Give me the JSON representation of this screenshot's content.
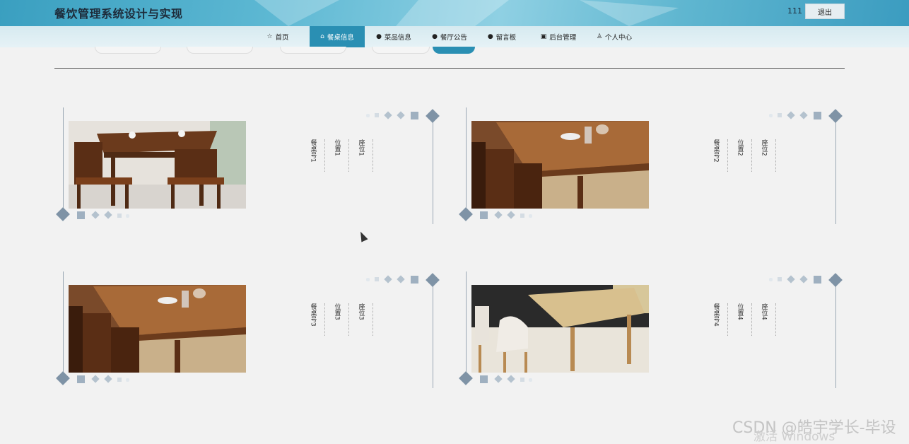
{
  "app": {
    "title": "餐饮管理系统设计与实现",
    "username": "111",
    "logout_label": "退出"
  },
  "nav": [
    {
      "label": "首页",
      "icon": "star-icon",
      "glyph": "☆"
    },
    {
      "label": "餐桌信息",
      "icon": "bag-icon",
      "glyph": "⌂"
    },
    {
      "label": "菜品信息",
      "icon": "info-circle-icon",
      "glyph": "●"
    },
    {
      "label": "餐厅公告",
      "icon": "question-circle-icon",
      "glyph": "●"
    },
    {
      "label": "留言板",
      "icon": "info-circle-icon",
      "glyph": "●"
    },
    {
      "label": "后台管理",
      "icon": "briefcase-icon",
      "glyph": "▣"
    },
    {
      "label": "个人中心",
      "icon": "user-icon",
      "glyph": "♙"
    }
  ],
  "active_nav": "餐桌信息",
  "cards": [
    {
      "table_no": "餐桌号1",
      "position": "位置1",
      "seats": "座位1"
    },
    {
      "table_no": "餐桌号2",
      "position": "位置2",
      "seats": "座位2"
    },
    {
      "table_no": "餐桌号3",
      "position": "位置3",
      "seats": "座位3"
    },
    {
      "table_no": "餐桌号4",
      "position": "位置4",
      "seats": "座位4"
    }
  ],
  "watermarks": {
    "csdn": "CSDN @皓宇学长-毕设",
    "windows": "激活 Windows"
  },
  "colors": {
    "accent": "#2a8fb3",
    "header": "#5db8d3"
  }
}
